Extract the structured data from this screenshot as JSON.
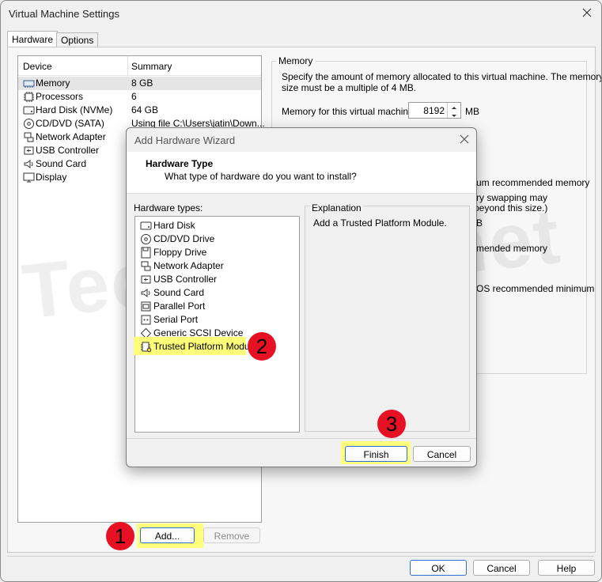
{
  "window": {
    "title": "Virtual Machine Settings"
  },
  "tabs": [
    "Hardware",
    "Options"
  ],
  "device_list": {
    "headers": {
      "device": "Device",
      "summary": "Summary"
    },
    "rows": [
      {
        "name": "Memory",
        "summary": "8 GB",
        "icon": "memory-icon",
        "selected": true
      },
      {
        "name": "Processors",
        "summary": "6",
        "icon": "processor-icon"
      },
      {
        "name": "Hard Disk (NVMe)",
        "summary": "64 GB",
        "icon": "hard-disk-icon"
      },
      {
        "name": "CD/DVD (SATA)",
        "summary": "Using file C:\\Users\\jatin\\Down...",
        "icon": "cd-dvd-icon"
      },
      {
        "name": "Network Adapter",
        "summary": "",
        "icon": "network-adapter-icon"
      },
      {
        "name": "USB Controller",
        "summary": "",
        "icon": "usb-icon"
      },
      {
        "name": "Sound Card",
        "summary": "",
        "icon": "sound-card-icon"
      },
      {
        "name": "Display",
        "summary": "",
        "icon": "display-icon"
      }
    ],
    "add_label": "Add...",
    "remove_label": "Remove"
  },
  "memory": {
    "group_label": "Memory",
    "desc_line1": "Specify the amount of memory allocated to this virtual machine. The memory",
    "desc_line2": "size must be a multiple of 4 MB.",
    "field_label": "Memory for this virtual machine:",
    "value": "8192",
    "unit": "MB",
    "partial_lines": [
      "um recommended memory",
      "ry swapping may",
      "beyond this size.)",
      "B",
      "mended memory",
      "OS recommended minimum"
    ]
  },
  "watermark": "Techpress.net",
  "wizard": {
    "title": "Add Hardware Wizard",
    "heading": "Hardware Type",
    "subheading": "What type of hardware do you want to install?",
    "types_label": "Hardware types:",
    "types": [
      {
        "name": "Hard Disk",
        "icon": "hard-disk-icon"
      },
      {
        "name": "CD/DVD Drive",
        "icon": "cd-dvd-icon"
      },
      {
        "name": "Floppy Drive",
        "icon": "floppy-icon"
      },
      {
        "name": "Network Adapter",
        "icon": "network-adapter-icon"
      },
      {
        "name": "USB Controller",
        "icon": "usb-icon"
      },
      {
        "name": "Sound Card",
        "icon": "sound-card-icon"
      },
      {
        "name": "Parallel Port",
        "icon": "parallel-port-icon"
      },
      {
        "name": "Serial Port",
        "icon": "serial-port-icon"
      },
      {
        "name": "Generic SCSI Device",
        "icon": "scsi-icon"
      },
      {
        "name": "Trusted Platform Module",
        "icon": "tpm-icon",
        "highlighted": true
      }
    ],
    "explanation_label": "Explanation",
    "explanation_text": "Add a Trusted Platform Module.",
    "finish_label": "Finish",
    "cancel_label": "Cancel"
  },
  "callouts": [
    "1",
    "2",
    "3"
  ],
  "footer": {
    "ok_label": "OK",
    "cancel_label": "Cancel",
    "help_label": "Help"
  },
  "colors": {
    "highlight": "#ffff7a",
    "badge": "#e81123",
    "accent": "#2b6fd6"
  }
}
